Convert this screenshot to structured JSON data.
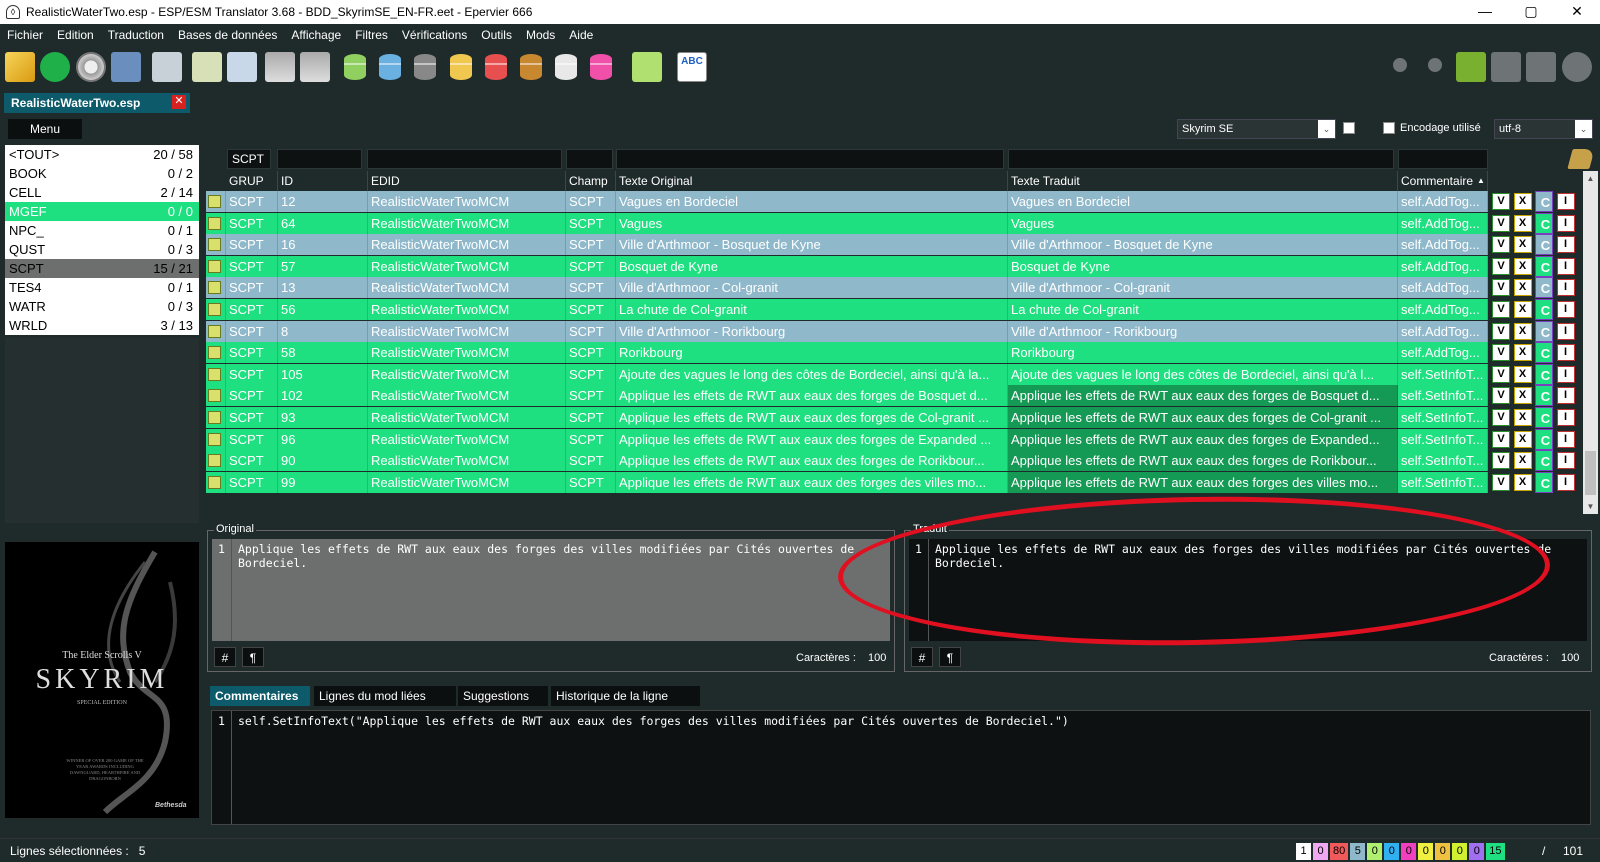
{
  "window": {
    "title": "RealisticWaterTwo.esp - ESP/ESM Translator 3.68 - BDD_SkyrimSE_EN-FR.eet - Epervier 666",
    "min": "—",
    "max": "▢",
    "close": "✕"
  },
  "menu": [
    "Fichier",
    "Edition",
    "Traduction",
    "Bases de données",
    "Affichage",
    "Filtres",
    "Vérifications",
    "Outils",
    "Mods",
    "Aide"
  ],
  "colors": {
    "accent_tab": "#0c5a6a",
    "row_blue": "#8fb8ca",
    "row_green": "#1fe080",
    "trad_dark_green": "#159a55",
    "highlight_ellipse": "#e01020"
  },
  "toolbar": {
    "spell_check_label": "ABC"
  },
  "file_tab": {
    "label": "RealisticWaterTwo.esp",
    "close": "✕"
  },
  "menu_button": "Menu",
  "game": {
    "selected": "Skyrim SE",
    "arrow": "⌄",
    "encoding_label": "Encodage utilisé",
    "encoding_value": "utf-8"
  },
  "categories": [
    {
      "name": "<TOUT>",
      "count": "20 / 58"
    },
    {
      "name": "BOOK",
      "count": "0 / 2"
    },
    {
      "name": "CELL",
      "count": "2 / 14"
    },
    {
      "name": "MGEF",
      "count": "0 / 0"
    },
    {
      "name": "NPC_",
      "count": "0 / 1"
    },
    {
      "name": "QUST",
      "count": "0 / 3"
    },
    {
      "name": "SCPT",
      "count": "15 / 21"
    },
    {
      "name": "TES4",
      "count": "0 / 1"
    },
    {
      "name": "WATR",
      "count": "0 / 3"
    },
    {
      "name": "WRLD",
      "count": "3 / 13"
    }
  ],
  "filter": {
    "grup": "SCPT"
  },
  "grid": {
    "headers": {
      "grup": "GRUP",
      "id": "ID",
      "edid": "EDID",
      "champ": "Champ",
      "original": "Texte Original",
      "traduit": "Texte Traduit",
      "commentaire": "Commentaire"
    },
    "actions": [
      "V",
      "X",
      "C",
      "I"
    ],
    "rows": [
      {
        "grup": "SCPT",
        "id": "12",
        "edid": "RealisticWaterTwoMCM",
        "champ": "SCPT",
        "original": "Vagues en Bordeciel",
        "traduit": "Vagues en Bordeciel",
        "commentaire": "self.AddTog...",
        "color": "blue"
      },
      {
        "grup": "SCPT",
        "id": "64",
        "edid": "RealisticWaterTwoMCM",
        "champ": "SCPT",
        "original": "Vagues",
        "traduit": "Vagues",
        "commentaire": "self.AddTog...",
        "color": "green"
      },
      {
        "grup": "SCPT",
        "id": "16",
        "edid": "RealisticWaterTwoMCM",
        "champ": "SCPT",
        "original": "Ville d'Arthmoor - Bosquet de Kyne",
        "traduit": "Ville d'Arthmoor - Bosquet de Kyne",
        "commentaire": "self.AddTog...",
        "color": "blue"
      },
      {
        "grup": "SCPT",
        "id": "57",
        "edid": "RealisticWaterTwoMCM",
        "champ": "SCPT",
        "original": "Bosquet de Kyne",
        "traduit": "Bosquet de Kyne",
        "commentaire": "self.AddTog...",
        "color": "green"
      },
      {
        "grup": "SCPT",
        "id": "13",
        "edid": "RealisticWaterTwoMCM",
        "champ": "SCPT",
        "original": "Ville d'Arthmoor - Col-granit",
        "traduit": "Ville d'Arthmoor - Col-granit",
        "commentaire": "self.AddTog...",
        "color": "blue"
      },
      {
        "grup": "SCPT",
        "id": "56",
        "edid": "RealisticWaterTwoMCM",
        "champ": "SCPT",
        "original": "La chute de Col-granit",
        "traduit": "La chute de Col-granit",
        "commentaire": "self.AddTog...",
        "color": "green"
      },
      {
        "grup": "SCPT",
        "id": "8",
        "edid": "RealisticWaterTwoMCM",
        "champ": "SCPT",
        "original": "Ville d'Arthmoor - Rorikbourg",
        "traduit": "Ville d'Arthmoor - Rorikbourg",
        "commentaire": "self.AddTog...",
        "color": "blue"
      },
      {
        "grup": "SCPT",
        "id": "58",
        "edid": "RealisticWaterTwoMCM",
        "champ": "SCPT",
        "original": "Rorikbourg",
        "traduit": "Rorikbourg",
        "commentaire": "self.AddTog...",
        "color": "green"
      },
      {
        "grup": "SCPT",
        "id": "105",
        "edid": "RealisticWaterTwoMCM",
        "champ": "SCPT",
        "original": "Ajoute des vagues le long des côtes de Bordeciel, ainsi qu'à la...",
        "traduit": "Ajoute des vagues le long des côtes de Bordeciel, ainsi qu'à l...",
        "commentaire": "self.SetInfoT...",
        "color": "green"
      },
      {
        "grup": "SCPT",
        "id": "102",
        "edid": "RealisticWaterTwoMCM",
        "champ": "SCPT",
        "original": "Applique les effets de RWT aux eaux des forges de Bosquet d...",
        "traduit": "Applique les effets de RWT aux eaux des forges de Bosquet d...",
        "commentaire": "self.SetInfoT...",
        "color": "green-dark"
      },
      {
        "grup": "SCPT",
        "id": "93",
        "edid": "RealisticWaterTwoMCM",
        "champ": "SCPT",
        "original": "Applique les effets de RWT aux eaux des forges de Col-granit ...",
        "traduit": "Applique les effets de RWT aux eaux des forges de Col-granit ...",
        "commentaire": "self.SetInfoT...",
        "color": "green-dark"
      },
      {
        "grup": "SCPT",
        "id": "96",
        "edid": "RealisticWaterTwoMCM",
        "champ": "SCPT",
        "original": "Applique les effets de RWT aux eaux des forges de Expanded ...",
        "traduit": "Applique les effets de RWT aux eaux des forges de Expanded...",
        "commentaire": "self.SetInfoT...",
        "color": "green-dark"
      },
      {
        "grup": "SCPT",
        "id": "90",
        "edid": "RealisticWaterTwoMCM",
        "champ": "SCPT",
        "original": "Applique les effets de RWT aux eaux des forges de Rorikbour...",
        "traduit": "Applique les effets de RWT aux eaux des forges de Rorikbour...",
        "commentaire": "self.SetInfoT...",
        "color": "green-dark"
      },
      {
        "grup": "SCPT",
        "id": "99",
        "edid": "RealisticWaterTwoMCM",
        "champ": "SCPT",
        "original": "Applique les effets de RWT aux eaux des forges des villes mo...",
        "traduit": "Applique les effets de RWT aux eaux des forges des villes mo...",
        "commentaire": "self.SetInfoT...",
        "color": "green-dark"
      }
    ]
  },
  "original_panel": {
    "legend": "Original",
    "line_no": "1",
    "text": "Applique les effets de RWT aux eaux des forges des villes modifiées par Cités ouvertes de Bordeciel.",
    "hash_btn": "#",
    "para_btn": "¶",
    "chars_label": "Caractères :",
    "chars_value": "100"
  },
  "traduit_panel": {
    "legend": "Traduit",
    "line_no": "1",
    "text": "Applique les effets de RWT aux eaux des forges des villes modifiées par Cités ouvertes de Bordeciel.",
    "hash_btn": "#",
    "para_btn": "¶",
    "chars_label": "Caractères :",
    "chars_value": "100"
  },
  "bottom_tabs": [
    "Commentaires",
    "Lignes du mod liées",
    "Suggestions",
    "Historique de la ligne"
  ],
  "comment_editor": {
    "line_no": "1",
    "text": "self.SetInfoText(\"Applique les effets de RWT aux eaux des forges des villes modifiées par Cités ouvertes de Bordeciel.\")"
  },
  "game_art": {
    "subtitle": "The Elder Scrolls V",
    "logo": "SKYRIM",
    "edition": "SPECIAL EDITION",
    "blurb": "WINNER OF OVER 200 GAME OF THE YEAR AWARDS INCLUDING DAWNGUARD, HEARTHFIRE AND DRAGONBORN",
    "publisher": "Bethesda"
  },
  "status": {
    "selected_label": "Lignes sélectionnées :",
    "selected_value": "5",
    "counters": [
      {
        "value": "1",
        "color": "#ffffff"
      },
      {
        "value": "0",
        "color": "#f0a8f0"
      },
      {
        "value": "80",
        "color": "#f05a5a"
      },
      {
        "value": "5",
        "color": "#8fb8ca"
      },
      {
        "value": "0",
        "color": "#b0f070"
      },
      {
        "value": "0",
        "color": "#30b0f0"
      },
      {
        "value": "0",
        "color": "#f040c0"
      },
      {
        "value": "0",
        "color": "#f0f040"
      },
      {
        "value": "0",
        "color": "#f0c040"
      },
      {
        "value": "0",
        "color": "#d0f030"
      },
      {
        "value": "0",
        "color": "#a070f0"
      },
      {
        "value": "15",
        "color": "#1fe080"
      }
    ],
    "total_sep": "/",
    "total": "101"
  }
}
